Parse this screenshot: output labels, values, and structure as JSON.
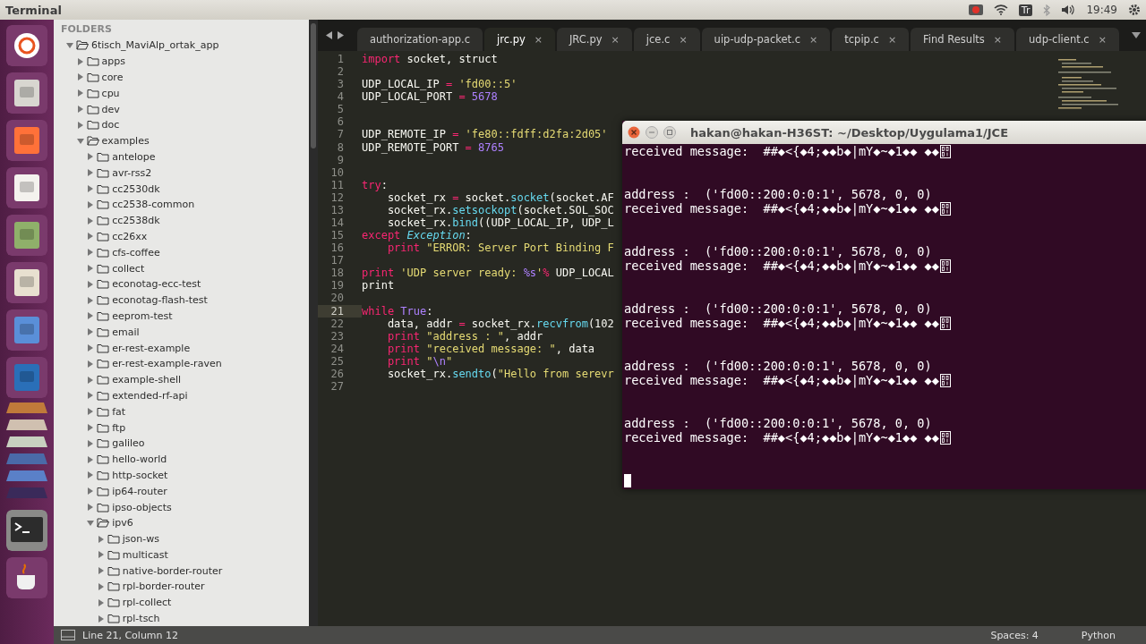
{
  "top_bar": {
    "app_title": "Terminal",
    "keyboard_indicator": "Tr",
    "clock": "19:49"
  },
  "sidebar": {
    "heading": "FOLDERS",
    "tree": [
      {
        "label": "6tisch_MaviAlp_ortak_app",
        "expanded": true,
        "children": [
          {
            "label": "apps",
            "expanded": false
          },
          {
            "label": "core",
            "expanded": false
          },
          {
            "label": "cpu",
            "expanded": false
          },
          {
            "label": "dev",
            "expanded": false
          },
          {
            "label": "doc",
            "expanded": false
          },
          {
            "label": "examples",
            "expanded": true,
            "children": [
              {
                "label": "antelope",
                "expanded": false
              },
              {
                "label": "avr-rss2",
                "expanded": false
              },
              {
                "label": "cc2530dk",
                "expanded": false
              },
              {
                "label": "cc2538-common",
                "expanded": false
              },
              {
                "label": "cc2538dk",
                "expanded": false
              },
              {
                "label": "cc26xx",
                "expanded": false
              },
              {
                "label": "cfs-coffee",
                "expanded": false
              },
              {
                "label": "collect",
                "expanded": false
              },
              {
                "label": "econotag-ecc-test",
                "expanded": false
              },
              {
                "label": "econotag-flash-test",
                "expanded": false
              },
              {
                "label": "eeprom-test",
                "expanded": false
              },
              {
                "label": "email",
                "expanded": false
              },
              {
                "label": "er-rest-example",
                "expanded": false
              },
              {
                "label": "er-rest-example-raven",
                "expanded": false
              },
              {
                "label": "example-shell",
                "expanded": false
              },
              {
                "label": "extended-rf-api",
                "expanded": false
              },
              {
                "label": "fat",
                "expanded": false
              },
              {
                "label": "ftp",
                "expanded": false
              },
              {
                "label": "galileo",
                "expanded": false
              },
              {
                "label": "hello-world",
                "expanded": false
              },
              {
                "label": "http-socket",
                "expanded": false
              },
              {
                "label": "ip64-router",
                "expanded": false
              },
              {
                "label": "ipso-objects",
                "expanded": false
              },
              {
                "label": "ipv6",
                "expanded": true,
                "children": [
                  {
                    "label": "json-ws",
                    "expanded": false
                  },
                  {
                    "label": "multicast",
                    "expanded": false
                  },
                  {
                    "label": "native-border-router",
                    "expanded": false
                  },
                  {
                    "label": "rpl-border-router",
                    "expanded": false
                  },
                  {
                    "label": "rpl-collect",
                    "expanded": false
                  },
                  {
                    "label": "rpl-tsch",
                    "expanded": false
                  }
                ]
              }
            ]
          }
        ]
      }
    ]
  },
  "tabs": [
    {
      "label": "authorization-app.c",
      "selected": false
    },
    {
      "label": "jrc.py",
      "selected": true,
      "close": "×"
    },
    {
      "label": "JRC.py",
      "selected": false,
      "close": "×"
    },
    {
      "label": "jce.c",
      "selected": false,
      "close": "×"
    },
    {
      "label": "uip-udp-packet.c",
      "selected": false,
      "close": "×"
    },
    {
      "label": "tcpip.c",
      "selected": false,
      "close": "×"
    },
    {
      "label": "Find Results",
      "selected": false,
      "close": "×"
    },
    {
      "label": "udp-client.c",
      "selected": false,
      "close": "×"
    }
  ],
  "editor": {
    "lines": [
      {
        "number": "1",
        "current": false,
        "segments": [
          {
            "kind": "keyword",
            "text": "import"
          },
          {
            "kind": "plain",
            "text": " socket, struct"
          }
        ]
      },
      {
        "number": "2",
        "current": false
      },
      {
        "number": "3",
        "current": false,
        "segments": [
          {
            "kind": "plain",
            "text": "UDP_LOCAL_IP "
          },
          {
            "kind": "keyword",
            "text": "="
          },
          {
            "kind": "string",
            "text": " 'fd00::5'"
          }
        ]
      },
      {
        "number": "4",
        "current": false,
        "segments": [
          {
            "kind": "plain",
            "text": "UDP_LOCAL_PORT "
          },
          {
            "kind": "keyword",
            "text": "="
          },
          {
            "kind": "number",
            "text": " 5678"
          }
        ]
      },
      {
        "number": "5",
        "current": false
      },
      {
        "number": "6",
        "current": false
      },
      {
        "number": "7",
        "current": false,
        "segments": [
          {
            "kind": "plain",
            "text": "UDP_REMOTE_IP "
          },
          {
            "kind": "keyword",
            "text": "="
          },
          {
            "kind": "string",
            "text": " 'fe80::fdff:d2fa:2d05'"
          }
        ]
      },
      {
        "number": "8",
        "current": false,
        "segments": [
          {
            "kind": "plain",
            "text": "UDP_REMOTE_PORT "
          },
          {
            "kind": "keyword",
            "text": "="
          },
          {
            "kind": "number",
            "text": " 8765"
          }
        ]
      },
      {
        "number": "9",
        "current": false
      },
      {
        "number": "10",
        "current": false
      },
      {
        "number": "11",
        "current": false,
        "segments": [
          {
            "kind": "keyword",
            "text": "try"
          },
          {
            "kind": "plain",
            "text": ":"
          }
        ]
      },
      {
        "number": "12",
        "current": false,
        "segments": [
          {
            "kind": "plain",
            "text": "    socket_rx "
          },
          {
            "kind": "keyword",
            "text": "="
          },
          {
            "kind": "plain",
            "text": " socket."
          },
          {
            "kind": "func",
            "text": "socket"
          },
          {
            "kind": "plain",
            "text": "(socket.AF"
          }
        ]
      },
      {
        "number": "13",
        "current": false,
        "segments": [
          {
            "kind": "plain",
            "text": "    socket_rx."
          },
          {
            "kind": "func",
            "text": "setsockopt"
          },
          {
            "kind": "plain",
            "text": "(socket.SOL_SOC"
          }
        ]
      },
      {
        "number": "14",
        "current": false,
        "segments": [
          {
            "kind": "plain",
            "text": "    socket_rx."
          },
          {
            "kind": "func",
            "text": "bind"
          },
          {
            "kind": "plain",
            "text": "((UDP_LOCAL_IP, UDP_L"
          }
        ]
      },
      {
        "number": "15",
        "current": false,
        "segments": [
          {
            "kind": "keyword",
            "text": "except"
          },
          {
            "kind": "type",
            "text": " Exception"
          },
          {
            "kind": "plain",
            "text": ":"
          }
        ]
      },
      {
        "number": "16",
        "current": false,
        "segments": [
          {
            "kind": "keyword",
            "text": "    print"
          },
          {
            "kind": "string",
            "text": " \"ERROR: Server Port Binding F"
          }
        ]
      },
      {
        "number": "17",
        "current": false
      },
      {
        "number": "18",
        "current": false,
        "segments": [
          {
            "kind": "keyword",
            "text": "print"
          },
          {
            "kind": "string",
            "text": " 'UDP server ready: "
          },
          {
            "kind": "number",
            "text": "%s"
          },
          {
            "kind": "string",
            "text": "'"
          },
          {
            "kind": "keyword",
            "text": "%"
          },
          {
            "kind": "plain",
            "text": " UDP_LOCAL"
          }
        ]
      },
      {
        "number": "19",
        "current": false,
        "segments": [
          {
            "kind": "plain",
            "text": "print"
          }
        ]
      },
      {
        "number": "20",
        "current": false
      },
      {
        "number": "21",
        "current": true,
        "segments": [
          {
            "kind": "keyword",
            "text": "while"
          },
          {
            "kind": "number",
            "text": " True"
          },
          {
            "kind": "plain",
            "text": ":"
          }
        ]
      },
      {
        "number": "22",
        "current": false,
        "segments": [
          {
            "kind": "plain",
            "text": "    data, addr "
          },
          {
            "kind": "keyword",
            "text": "="
          },
          {
            "kind": "plain",
            "text": " socket_rx."
          },
          {
            "kind": "func",
            "text": "recvfrom"
          },
          {
            "kind": "plain",
            "text": "(102"
          }
        ]
      },
      {
        "number": "23",
        "current": false,
        "segments": [
          {
            "kind": "keyword",
            "text": "    print"
          },
          {
            "kind": "string",
            "text": " \"address : \""
          },
          {
            "kind": "plain",
            "text": ", addr"
          }
        ]
      },
      {
        "number": "24",
        "current": false,
        "segments": [
          {
            "kind": "keyword",
            "text": "    print"
          },
          {
            "kind": "string",
            "text": " \"received message: \""
          },
          {
            "kind": "plain",
            "text": ", data"
          }
        ]
      },
      {
        "number": "25",
        "current": false,
        "segments": [
          {
            "kind": "keyword",
            "text": "    print"
          },
          {
            "kind": "string",
            "text": " \""
          },
          {
            "kind": "number",
            "text": "\\n"
          },
          {
            "kind": "string",
            "text": "\""
          }
        ]
      },
      {
        "number": "26",
        "current": false,
        "segments": [
          {
            "kind": "plain",
            "text": "    socket_rx."
          },
          {
            "kind": "func",
            "text": "sendto"
          },
          {
            "kind": "plain",
            "text": "("
          },
          {
            "kind": "string",
            "text": "\"Hello from serevr"
          }
        ]
      },
      {
        "number": "27",
        "current": false
      }
    ]
  },
  "terminal": {
    "title": "hakan@hakan-H36ST: ~/Desktop/Uygulama1/JCE",
    "lines": [
      {
        "kind": "output_glyph",
        "text": "received message:  ##◆<{◆4;◆◆b◆|mY◆~◆1◆◆ ◆◆"
      },
      {
        "kind": "blank"
      },
      {
        "kind": "blank"
      },
      {
        "kind": "output",
        "text": "address :  ('fd00::200:0:0:1', 5678, 0, 0)"
      },
      {
        "kind": "output_glyph",
        "text": "received message:  ##◆<{◆4;◆◆b◆|mY◆~◆1◆◆ ◆◆"
      },
      {
        "kind": "blank"
      },
      {
        "kind": "blank"
      },
      {
        "kind": "output",
        "text": "address :  ('fd00::200:0:0:1', 5678, 0, 0)"
      },
      {
        "kind": "output_glyph",
        "text": "received message:  ##◆<{◆4;◆◆b◆|mY◆~◆1◆◆ ◆◆"
      },
      {
        "kind": "blank"
      },
      {
        "kind": "blank"
      },
      {
        "kind": "output",
        "text": "address :  ('fd00::200:0:0:1', 5678, 0, 0)"
      },
      {
        "kind": "output_glyph",
        "text": "received message:  ##◆<{◆4;◆◆b◆|mY◆~◆1◆◆ ◆◆"
      },
      {
        "kind": "blank"
      },
      {
        "kind": "blank"
      },
      {
        "kind": "output",
        "text": "address :  ('fd00::200:0:0:1', 5678, 0, 0)"
      },
      {
        "kind": "output_glyph",
        "text": "received message:  ##◆<{◆4;◆◆b◆|mY◆~◆1◆◆ ◆◆"
      },
      {
        "kind": "blank"
      },
      {
        "kind": "blank"
      },
      {
        "kind": "output",
        "text": "address :  ('fd00::200:0:0:1', 5678, 0, 0)"
      },
      {
        "kind": "output_glyph",
        "text": "received message:  ##◆<{◆4;◆◆b◆|mY◆~◆1◆◆ ◆◆"
      },
      {
        "kind": "blank"
      },
      {
        "kind": "blank"
      },
      {
        "kind": "cursor"
      }
    ]
  },
  "status_bar": {
    "position": "Line 21, Column 12",
    "indentation": "Spaces: 4",
    "syntax": "Python"
  }
}
